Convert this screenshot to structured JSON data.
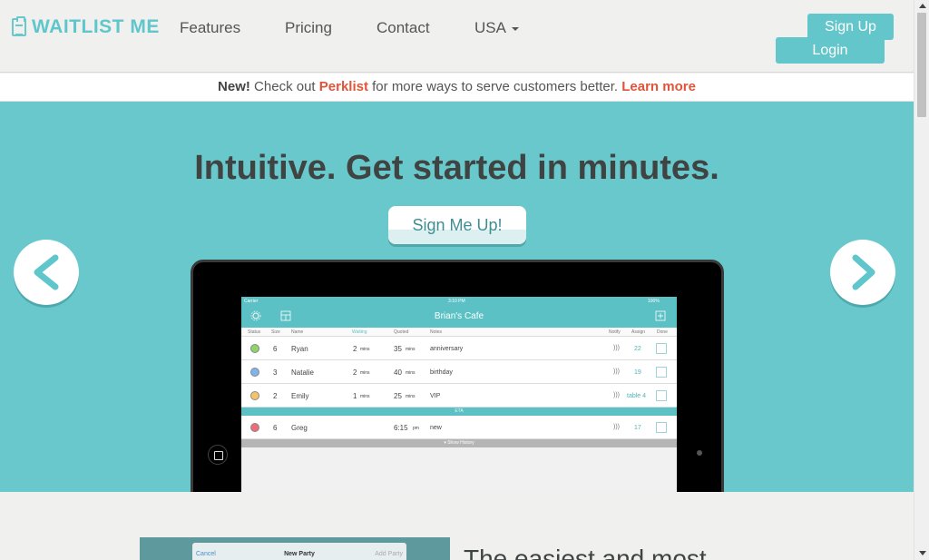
{
  "nav": {
    "brand": "WAITLIST ME",
    "links": [
      "Features",
      "Pricing",
      "Contact"
    ],
    "country": "USA",
    "signup": "Sign Up",
    "login": "Login"
  },
  "banner": {
    "new": "New!",
    "text1": "Check out",
    "perklist": "Perklist",
    "text2": "for more ways to serve customers better.",
    "learn_more": "Learn more"
  },
  "hero": {
    "title": "Intuitive. Get started in minutes.",
    "cta": "Sign Me Up!"
  },
  "app": {
    "status_left": "Carrier",
    "status_time": "3:10 PM",
    "status_battery": "100%",
    "title": "Brian's Cafe",
    "columns": [
      "Status",
      "Size",
      "Name",
      "Waiting",
      "Quoted",
      "Notes",
      "Notify",
      "Assign",
      "Done"
    ],
    "rows": [
      {
        "size": "6",
        "name": "Ryan",
        "wait_num": "2",
        "wait_unit": "mins",
        "quoted_num": "35",
        "quoted_unit": "mins",
        "notes": "anniversary",
        "assign": "22",
        "color": "#8fd36a"
      },
      {
        "size": "3",
        "name": "Natalie",
        "wait_num": "2",
        "wait_unit": "mins",
        "quoted_num": "40",
        "quoted_unit": "mins",
        "notes": "birthday",
        "assign": "19",
        "color": "#7fb3ef"
      },
      {
        "size": "2",
        "name": "Emily",
        "wait_num": "1",
        "wait_unit": "mins",
        "quoted_num": "25",
        "quoted_unit": "mins",
        "notes": "VIP",
        "assign": "table 4",
        "color": "#f5c46a"
      }
    ],
    "eta": "ETA",
    "eta_row": {
      "size": "6",
      "name": "Greg",
      "time": "6:15",
      "time_unit": "pm",
      "notes": "new",
      "assign": "17",
      "color": "#ef6b7a"
    },
    "show_history": "Show History"
  },
  "feature": {
    "modal_cancel": "Cancel",
    "modal_title": "New Party",
    "modal_add": "Add Party",
    "heading": "The easiest and most"
  }
}
